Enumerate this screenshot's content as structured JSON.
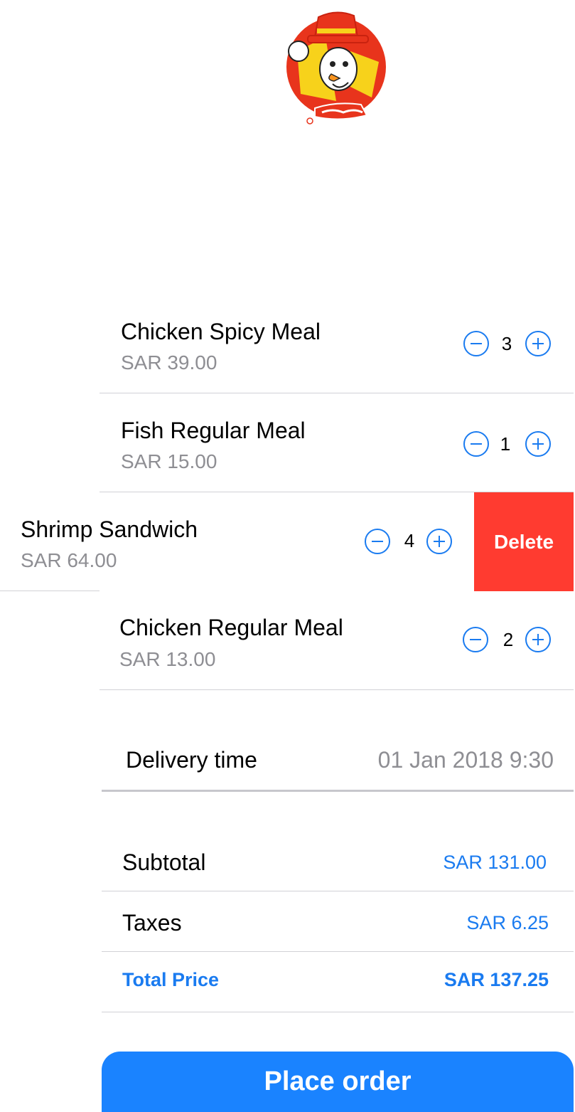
{
  "colors": {
    "accent": "#1a83ff",
    "link": "#1a7bf0",
    "delete": "#ff3b30",
    "secondary_text": "#8e8e93",
    "divider": "#d1d1d6"
  },
  "logo": {
    "icon": "restaurant-mascot-logo"
  },
  "cart": {
    "items": [
      {
        "name": "Chicken Spicy Meal",
        "price": "SAR 39.00",
        "qty": "3"
      },
      {
        "name": "Fish Regular Meal",
        "price": "SAR 15.00",
        "qty": "1"
      },
      {
        "name": "Shrimp Sandwich",
        "price": "SAR 64.00",
        "qty": "4"
      },
      {
        "name": "Chicken Regular Meal",
        "price": "SAR 13.00",
        "qty": "2"
      }
    ],
    "delete_label": "Delete"
  },
  "delivery": {
    "label": "Delivery time",
    "value": "01 Jan 2018 9:30"
  },
  "summary": {
    "subtotal_label": "Subtotal",
    "subtotal_value": "SAR 131.00",
    "taxes_label": "Taxes",
    "taxes_value": "SAR 6.25",
    "total_label": "Total Price",
    "total_value": "SAR 137.25"
  },
  "actions": {
    "place_order_label": "Place order"
  }
}
